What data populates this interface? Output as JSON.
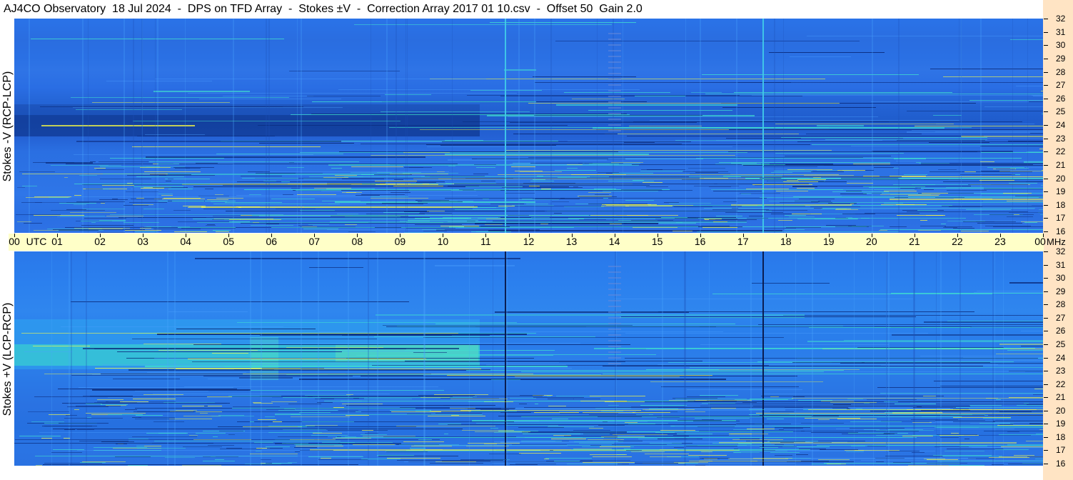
{
  "title": "AJ4CO Observatory  18 Jul 2024  -  DPS on TFD Array  -  Stokes ±V  -  Correction Array 2017 01 10.csv  -  Offset 50  Gain 2.0",
  "top_panel": {
    "ylabel": "Stokes -V (RCP-LCP)"
  },
  "bottom_panel": {
    "ylabel": "Stokes +V (LCP-RCP)"
  },
  "time_axis": {
    "utc_label": "UTC",
    "ticks": [
      "00",
      "01",
      "02",
      "03",
      "04",
      "05",
      "06",
      "07",
      "08",
      "09",
      "10",
      "11",
      "12",
      "13",
      "14",
      "15",
      "16",
      "17",
      "18",
      "19",
      "20",
      "21",
      "22",
      "23",
      "00"
    ],
    "unit": "MHz"
  },
  "freq_axis": {
    "ticks": [
      "32",
      "31",
      "30",
      "29",
      "28",
      "27",
      "26",
      "25",
      "24",
      "23",
      "22",
      "21",
      "20",
      "19",
      "18",
      "17",
      "16"
    ]
  },
  "colors": {
    "background": "#ffffff",
    "axis_bar": "#ffffc8",
    "right_strip": "#ffe4c4",
    "spectrogram_low": "#0a2a7a",
    "spectrogram_mid": "#2a70e4",
    "spectrogram_high": "#40e0d0",
    "rfi_hot": "#ffff40"
  }
}
